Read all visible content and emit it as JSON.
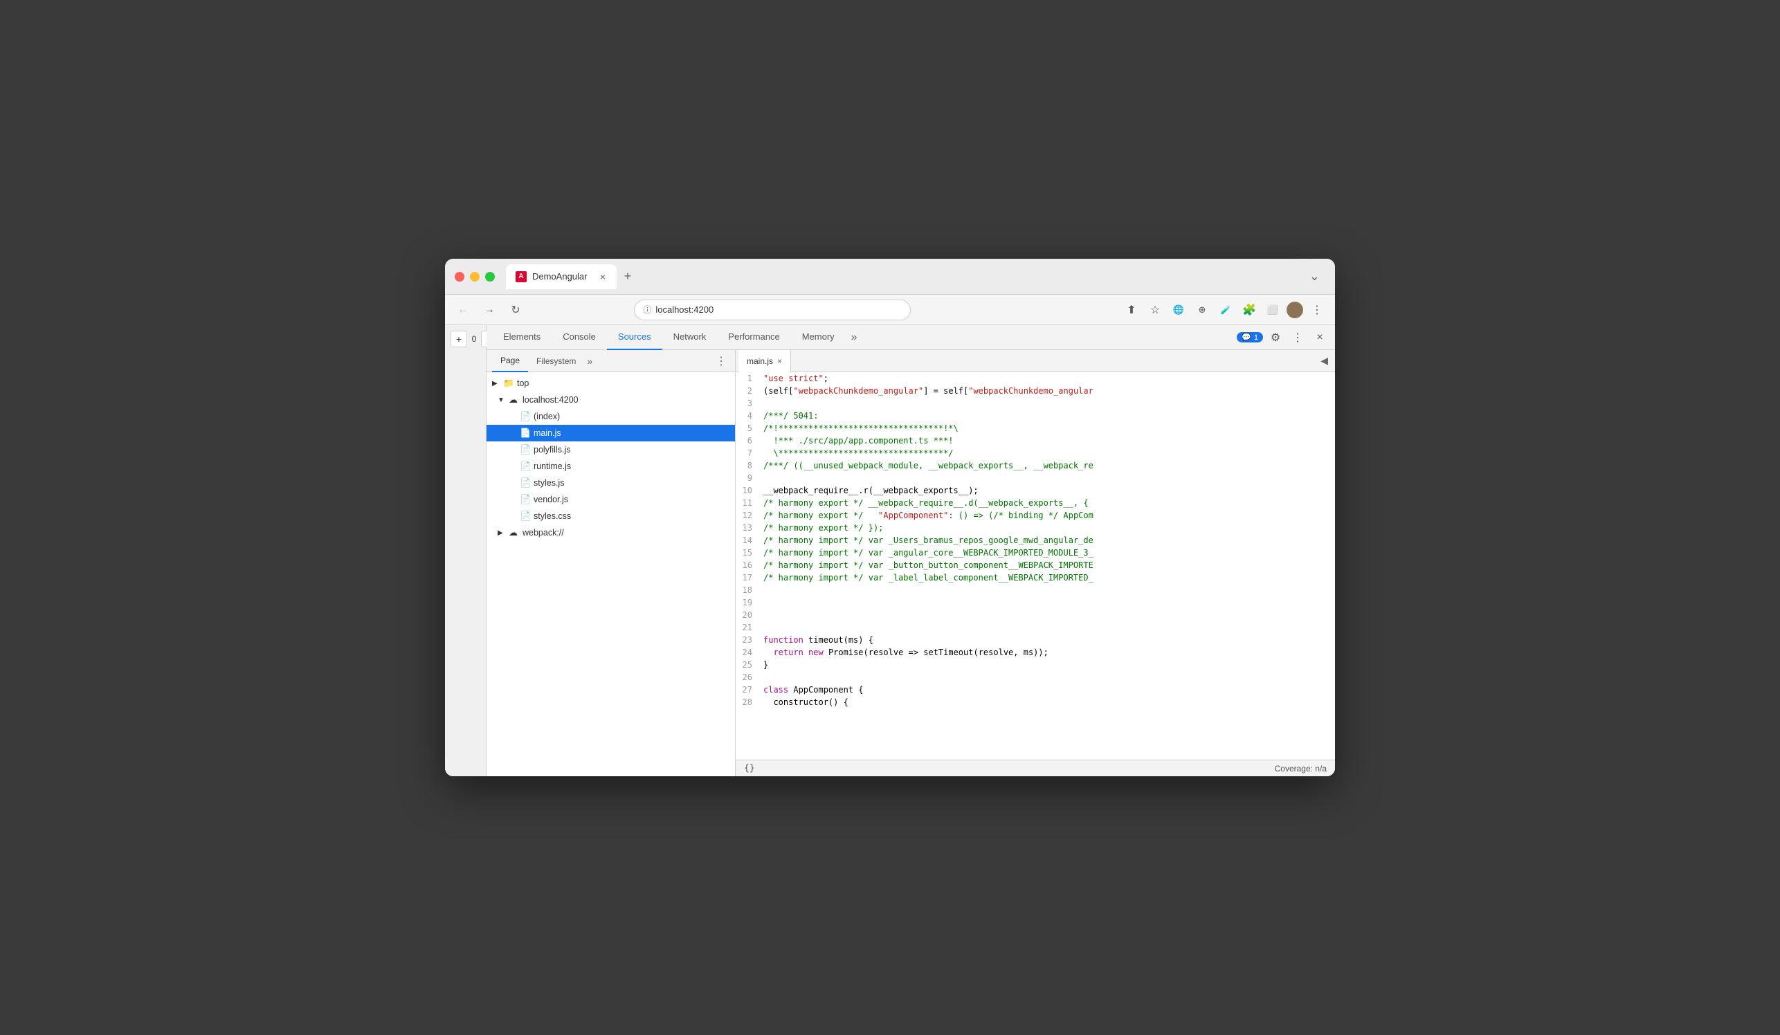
{
  "browser": {
    "title_bar": {
      "tab_title": "DemoAngular",
      "tab_close": "×",
      "tab_new": "+",
      "tab_end": "⌄"
    },
    "address_bar": {
      "url": "localhost:4200",
      "nav_back": "←",
      "nav_forward": "→",
      "nav_refresh": "↻"
    },
    "toolbar": {
      "upload": "⬆",
      "star": "☆",
      "puzzle": "🧩",
      "extension1": "⊕",
      "extension2": "★",
      "flask": "🧪",
      "layout": "⬜",
      "more": "⋮"
    },
    "zoom": {
      "plus": "+",
      "value": "0",
      "minus": "-"
    }
  },
  "devtools": {
    "tabs": [
      {
        "label": "Elements",
        "active": false
      },
      {
        "label": "Console",
        "active": false
      },
      {
        "label": "Sources",
        "active": true
      },
      {
        "label": "Network",
        "active": false
      },
      {
        "label": "Performance",
        "active": false
      },
      {
        "label": "Memory",
        "active": false
      }
    ],
    "tabs_more": "»",
    "badge_count": "1",
    "badge_icon": "💬",
    "action_settings": "⚙",
    "action_more": "⋮",
    "action_close": "×",
    "sources": {
      "file_tree_tabs": [
        {
          "label": "Page",
          "active": true
        },
        {
          "label": "Filesystem",
          "active": false
        }
      ],
      "file_tree_more": "»",
      "file_tree_menu": "⋮",
      "tree": [
        {
          "id": "top",
          "label": "top",
          "indent": 0,
          "arrow": "▶",
          "icon": "📁",
          "expanded": true
        },
        {
          "id": "localhost",
          "label": "localhost:4200",
          "indent": 1,
          "arrow": "▼",
          "icon": "☁",
          "expanded": true
        },
        {
          "id": "index",
          "label": "(index)",
          "indent": 2,
          "arrow": "",
          "icon": "📄"
        },
        {
          "id": "main.js",
          "label": "main.js",
          "indent": 2,
          "arrow": "",
          "icon": "📄",
          "selected": true
        },
        {
          "id": "polyfills.js",
          "label": "polyfills.js",
          "indent": 2,
          "arrow": "",
          "icon": "📄"
        },
        {
          "id": "runtime.js",
          "label": "runtime.js",
          "indent": 2,
          "arrow": "",
          "icon": "📄"
        },
        {
          "id": "styles.js",
          "label": "styles.js",
          "indent": 2,
          "arrow": "",
          "icon": "📄"
        },
        {
          "id": "vendor.js",
          "label": "vendor.js",
          "indent": 2,
          "arrow": "",
          "icon": "📄"
        },
        {
          "id": "styles.css",
          "label": "styles.css",
          "indent": 2,
          "arrow": "",
          "icon": "📄",
          "css": true
        },
        {
          "id": "webpack",
          "label": "webpack://",
          "indent": 1,
          "arrow": "▶",
          "icon": "☁"
        }
      ],
      "code_tabs": [
        {
          "label": "main.js",
          "close": "×"
        }
      ],
      "code_panel_end": "◀",
      "code": [
        {
          "ln": 1,
          "content": [
            {
              "t": "string",
              "v": "\"use strict\";"
            }
          ]
        },
        {
          "ln": 2,
          "content": [
            {
              "t": "plain",
              "v": "(self["
            },
            {
              "t": "string",
              "v": "\"webpackChunkdemo_angular\""
            },
            {
              "t": "plain",
              "v": "] = self["
            },
            {
              "t": "string",
              "v": "\"webpackChunkdemo_angular"
            }
          ]
        },
        {
          "ln": 3,
          "content": []
        },
        {
          "ln": 4,
          "content": [
            {
              "t": "comment",
              "v": "/***/ 5041:"
            }
          ]
        },
        {
          "ln": 5,
          "content": [
            {
              "t": "comment",
              "v": "/*!*********************************!*\\"
            }
          ]
        },
        {
          "ln": 6,
          "content": [
            {
              "t": "comment",
              "v": "  !*** ./src/app/app.component.ts ***!"
            }
          ]
        },
        {
          "ln": 7,
          "content": [
            {
              "t": "comment",
              "v": "  \\**********************************/"
            }
          ]
        },
        {
          "ln": 8,
          "content": [
            {
              "t": "comment",
              "v": "/***/ ((__unused_webpack_module, __webpack_exports__, __webpack_re"
            }
          ]
        },
        {
          "ln": 9,
          "content": []
        },
        {
          "ln": 10,
          "content": [
            {
              "t": "plain",
              "v": "__webpack_require__.r(__webpack_exports__);"
            }
          ]
        },
        {
          "ln": 11,
          "content": [
            {
              "t": "comment",
              "v": "/* harmony export */ __webpack_require__.d(__webpack_exports__, {"
            }
          ]
        },
        {
          "ln": 12,
          "content": [
            {
              "t": "comment",
              "v": "/* harmony export */   "
            },
            {
              "t": "string",
              "v": "\"AppComponent\""
            },
            {
              "t": "comment",
              "v": ": () => (/* binding */ AppCom"
            }
          ]
        },
        {
          "ln": 13,
          "content": [
            {
              "t": "comment",
              "v": "/* harmony export */ });"
            }
          ]
        },
        {
          "ln": 14,
          "content": [
            {
              "t": "comment",
              "v": "/* harmony import */ var _Users_bramus_repos_google_mwd_angular_de"
            }
          ]
        },
        {
          "ln": 15,
          "content": [
            {
              "t": "comment",
              "v": "/* harmony import */ var _angular_core__WEBPACK_IMPORTED_MODULE_3_"
            }
          ]
        },
        {
          "ln": 16,
          "content": [
            {
              "t": "comment",
              "v": "/* harmony import */ var _button_button_component__WEBPACK_IMPORTE"
            }
          ]
        },
        {
          "ln": 17,
          "content": [
            {
              "t": "comment",
              "v": "/* harmony import */ var _label_label_component__WEBPACK_IMPORTED_"
            }
          ]
        },
        {
          "ln": 18,
          "content": []
        },
        {
          "ln": 19,
          "content": []
        },
        {
          "ln": 20,
          "content": []
        },
        {
          "ln": 21,
          "content": []
        },
        {
          "ln": 23,
          "content": [
            {
              "t": "keyword",
              "v": "function"
            },
            {
              "t": "plain",
              "v": " timeout(ms) {"
            }
          ]
        },
        {
          "ln": 24,
          "content": [
            {
              "t": "plain",
              "v": "  "
            },
            {
              "t": "keyword",
              "v": "return"
            },
            {
              "t": "plain",
              "v": " "
            },
            {
              "t": "keyword",
              "v": "new"
            },
            {
              "t": "plain",
              "v": " Promise(resolve => setTimeout(resolve, ms));"
            }
          ]
        },
        {
          "ln": 25,
          "content": [
            {
              "t": "plain",
              "v": "}"
            }
          ]
        },
        {
          "ln": 26,
          "content": []
        },
        {
          "ln": 27,
          "content": [
            {
              "t": "keyword",
              "v": "class"
            },
            {
              "t": "plain",
              "v": " AppComponent {"
            }
          ]
        },
        {
          "ln": 28,
          "content": [
            {
              "t": "plain",
              "v": "  constructor() {"
            }
          ]
        }
      ],
      "bottom_bar": {
        "braces": "{}",
        "coverage": "Coverage: n/a"
      }
    }
  }
}
